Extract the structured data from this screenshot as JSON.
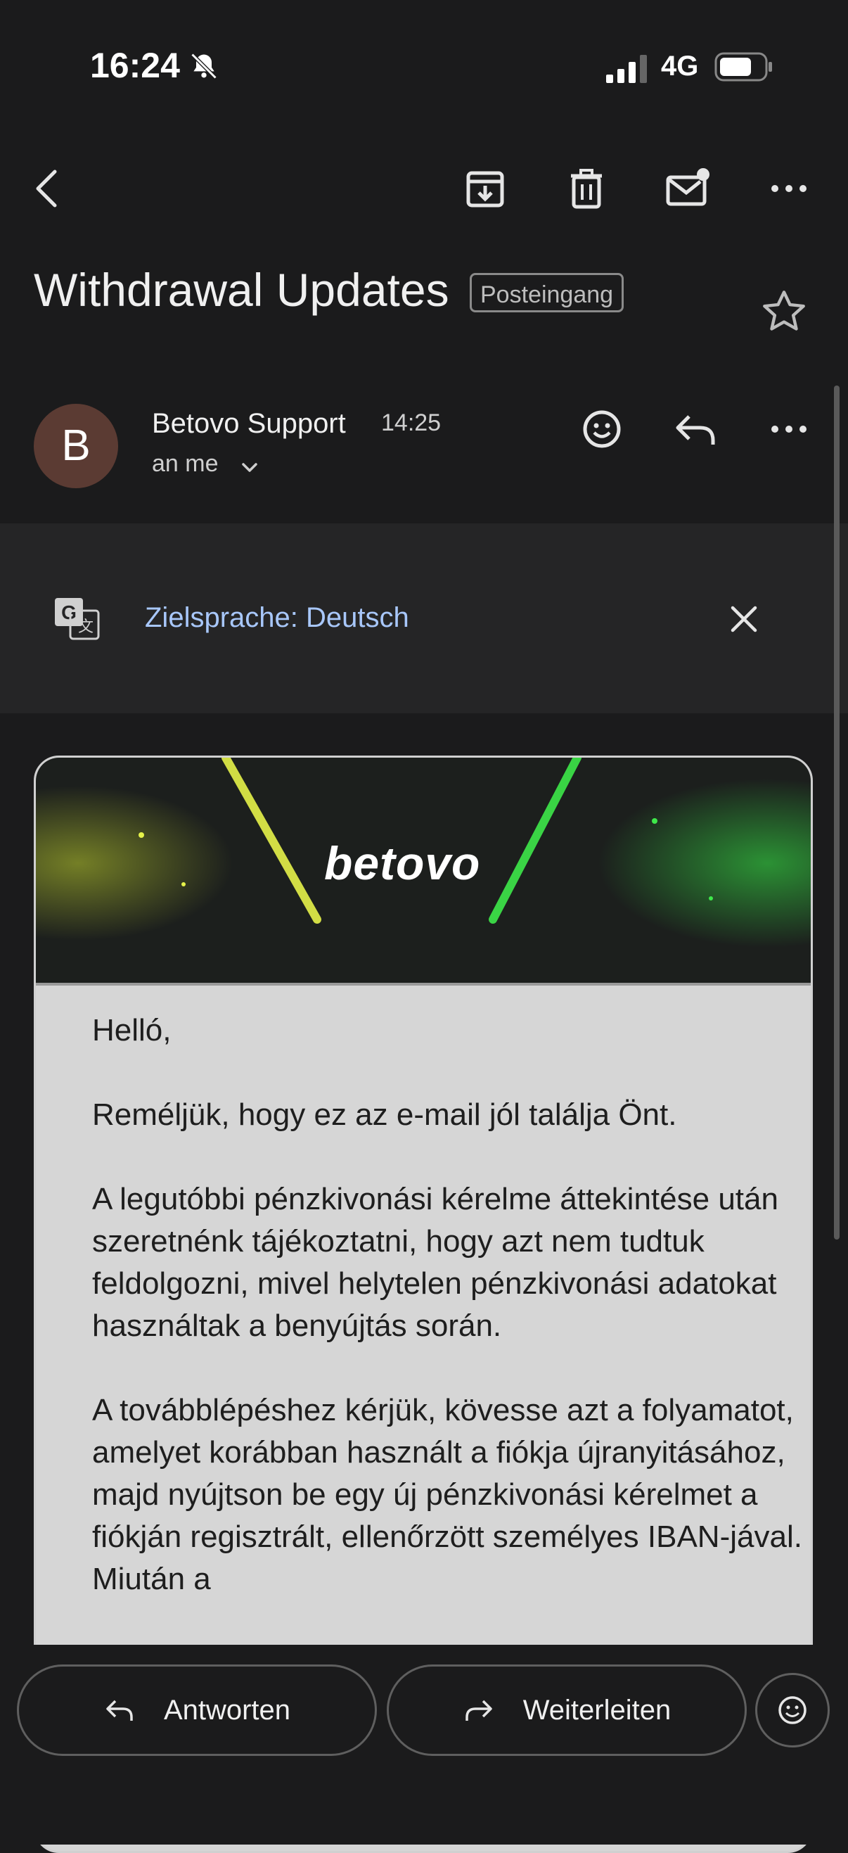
{
  "status": {
    "time": "16:24",
    "network": "4G"
  },
  "toolbar": {
    "back": "back-icon",
    "archive": "archive-icon",
    "delete": "trash-icon",
    "unread": "mark-unread-icon",
    "more": "more-icon"
  },
  "subject": {
    "title": "Withdrawal Updates",
    "label": "Posteingang"
  },
  "message": {
    "avatar_letter": "B",
    "sender": "Betovo Support",
    "time": "14:25",
    "to": "an me"
  },
  "translate": {
    "text": "Zielsprache: Deutsch"
  },
  "email": {
    "banner_logo": "betovo",
    "paragraphs": [
      "Helló,",
      "Reméljük, hogy ez az e-mail jól találja Önt.",
      "A legutóbbi pénzkivonási kérelme áttekintése után szeretnénk tájékoztatni, hogy azt nem tudtuk feldolgozni, mivel helytelen pénzkivonási adatokat használtak a benyújtás során.",
      "A továbblépéshez kérjük, kövesse azt a folyamatot, amelyet korábban használt a fiókja újranyitásához, majd nyújtson be egy új pénzkivonási kérelmet a fiókján regisztrált, ellenőrzött személyes IBAN-jával. Miután a"
    ]
  },
  "actions": {
    "reply": "Antworten",
    "forward": "Weiterleiten"
  },
  "colors": {
    "background": "#1b1b1c",
    "translate_link": "#a8c7fa",
    "avatar": "#5b3b33"
  }
}
